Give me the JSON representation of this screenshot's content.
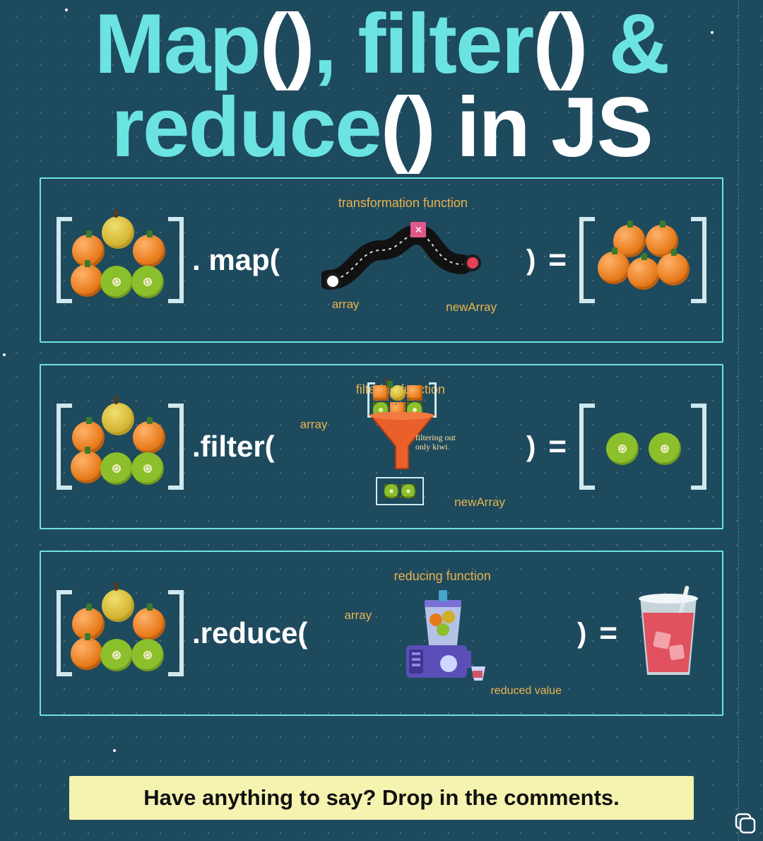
{
  "title": {
    "line1_pre": "Map",
    "line1_parens": "()",
    "line1_mid": ", filter",
    "line1_parens2": "()",
    "line1_post": " &",
    "line2_pre": "reduce",
    "line2_parens": "()",
    "line2_post": " in JS"
  },
  "methods": {
    "map": {
      "call": ". map(",
      "close": ")",
      "eq": "=",
      "label_top": "transformation function",
      "label_in": "array",
      "label_out": "newArray"
    },
    "filter": {
      "call": ".filter(",
      "close": ")",
      "eq": "=",
      "label_top": "filtering function",
      "label_in": "array",
      "label_out": "newArray",
      "funnel_note_l1": "filtering out",
      "funnel_note_l2": "only kiwi"
    },
    "reduce": {
      "call": ".reduce(",
      "close": ")",
      "eq": "=",
      "label_top": "reducing function",
      "label_in": "array",
      "label_out": "reduced value"
    }
  },
  "cta": "Have anything to say? Drop in the comments.",
  "icons": {
    "slides": "carousel-indicator-icon"
  }
}
